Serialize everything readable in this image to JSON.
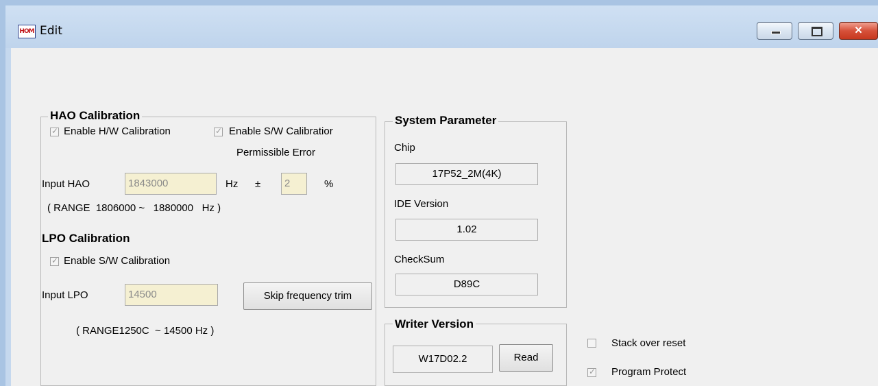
{
  "window": {
    "title": "Edit",
    "icon": "app-logo-icon",
    "icon_text": "HOM",
    "close_glyph": "✕"
  },
  "hao": {
    "group_title": "HAO Calibration",
    "hw_checkbox_label": "Enable H/W Calibration",
    "sw_checkbox_label": "Enable S/W Calibratior",
    "permissible_error_label": "Permissible Error",
    "input_label": "Input HAO",
    "input_value": "1843000",
    "unit_hz": "Hz",
    "plusminus": "±",
    "error_value": "2",
    "percent": "%",
    "range_text": "( RANGE  1806000 ~   1880000   Hz )"
  },
  "lpo": {
    "group_title": "LPO Calibration",
    "sw_checkbox_label": "Enable S/W Calibration",
    "input_label": "Input LPO",
    "input_value": "14500",
    "skip_button": "Skip frequency trim",
    "range_text": "( RANGE1250C  ~ 14500 Hz )"
  },
  "system": {
    "group_title": "System Parameter",
    "chip_label": "Chip",
    "chip_value": "17P52_2M(4K)",
    "ide_label": "IDE Version",
    "ide_value": "1.02",
    "checksum_label": "CheckSum",
    "checksum_value": "D89C"
  },
  "writer": {
    "group_title": "Writer Version",
    "version_value": "W17D02.2",
    "read_button": "Read"
  },
  "options": {
    "stack_over_reset": "Stack over reset",
    "program_protect": "Program Protect"
  },
  "colors": {
    "titlebar": "#c5d8ee",
    "client_bg": "#f0f0f0",
    "input_bg": "#f5f0d2",
    "close_button": "#c7381f"
  }
}
